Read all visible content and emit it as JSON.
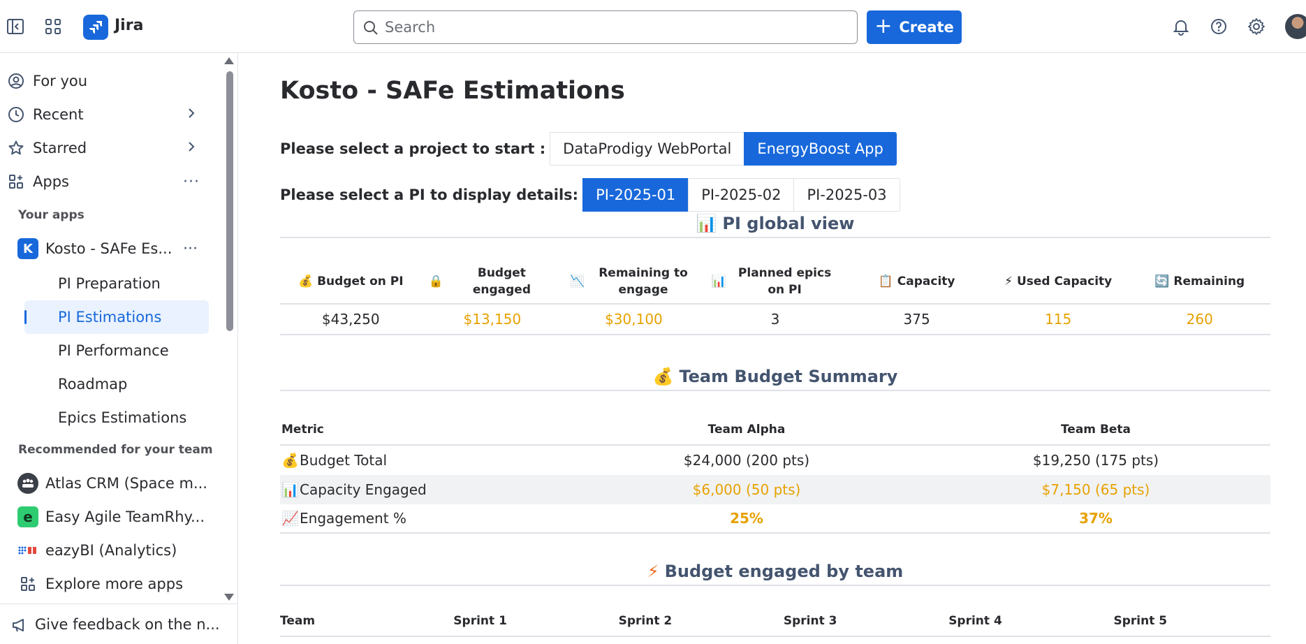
{
  "topbar": {
    "app_name": "Jira",
    "search_placeholder": "Search",
    "create_label": "Create",
    "icons": [
      "sidebar-toggle-icon",
      "app-switcher-icon",
      "bell-icon",
      "help-icon",
      "gear-icon"
    ]
  },
  "sidebar": {
    "nav": [
      {
        "label": "For you",
        "icon": "person-circle-icon"
      },
      {
        "label": "Recent",
        "icon": "clock-icon"
      },
      {
        "label": "Starred",
        "icon": "star-icon"
      },
      {
        "label": "Apps",
        "icon": "apps-icon"
      }
    ],
    "your_apps_label": "Your apps",
    "current_app": {
      "label": "Kosto - SAFe Es...",
      "icon_letter": "K"
    },
    "sub_items": [
      {
        "label": "PI Preparation"
      },
      {
        "label": "PI Estimations"
      },
      {
        "label": "PI Performance"
      },
      {
        "label": "Roadmap"
      },
      {
        "label": "Epics Estimations"
      }
    ],
    "recommended_label": "Recommended for your team",
    "recommended": [
      {
        "label": "Atlas CRM (Space m..."
      },
      {
        "label": "Easy Agile TeamRhy..."
      },
      {
        "label": "eazyBI (Analytics)"
      }
    ],
    "explore_label": "Explore more apps",
    "feedback_label": "Give feedback on the n..."
  },
  "main": {
    "title": "Kosto - SAFe Estimations",
    "project_prompt": "Please select a project to start :",
    "projects": [
      "DataProdigy WebPortal",
      "EnergyBoost App"
    ],
    "active_project": 1,
    "pi_prompt": "Please select a PI to display details:",
    "pis": [
      "PI-2025-01",
      "PI-2025-02",
      "PI-2025-03"
    ],
    "active_pi": 0,
    "global_view": {
      "title": "PI global view",
      "emoji": "📊",
      "headers": [
        {
          "emoji": "💰",
          "label": "Budget on PI"
        },
        {
          "emoji": "🔒",
          "label": "Budget engaged"
        },
        {
          "emoji": "📉",
          "label": "Remaining to engage"
        },
        {
          "emoji": "📊",
          "label": "Planned epics on PI"
        },
        {
          "emoji": "📋",
          "label": "Capacity"
        },
        {
          "emoji": "⚡",
          "label": "Used Capacity"
        },
        {
          "emoji": "🔄",
          "label": "Remaining"
        }
      ],
      "values": [
        "$43,250",
        "$13,150",
        "$30,100",
        "3",
        "375",
        "115",
        "260"
      ]
    },
    "team_budget": {
      "title": "Team Budget Summary",
      "emoji": "💰",
      "headers": [
        "Metric",
        "Team Alpha",
        "Team Beta"
      ],
      "rows": [
        {
          "emoji": "💰",
          "metric": "Budget Total",
          "alpha": "$24,000 (200 pts)",
          "beta": "$19,250 (175 pts)"
        },
        {
          "emoji": "📊",
          "metric": "Capacity Engaged",
          "alpha": "$6,000 (50 pts)",
          "beta": "$7,150 (65 pts)"
        },
        {
          "emoji": "📈",
          "metric": "Engagement %",
          "alpha": "25%",
          "beta": "37%"
        }
      ]
    },
    "budget_by_team": {
      "title": "Budget engaged by team",
      "emoji": "⚡",
      "headers": [
        "Team",
        "Sprint 1",
        "Sprint 2",
        "Sprint 3",
        "Sprint 4",
        "Sprint 5"
      ]
    }
  },
  "colors": {
    "brand": "#1868db",
    "highlight_orange": "#e7a100",
    "active_bg": "#e9f2fe"
  }
}
